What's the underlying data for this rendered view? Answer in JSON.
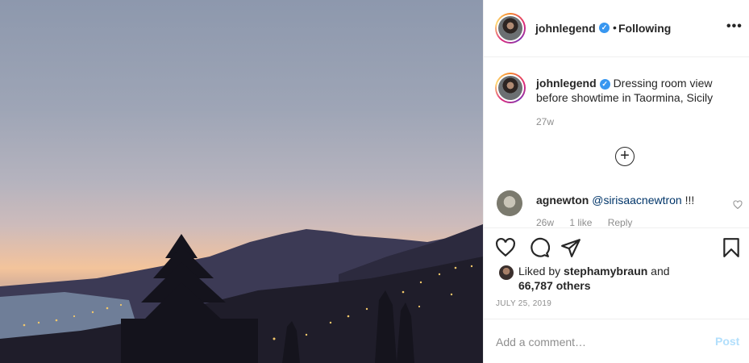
{
  "post": {
    "username": "johnlegend",
    "follow_state": "Following",
    "separator": "•",
    "more_glyph": "•••",
    "caption": "Dressing room view before showtime in Taormina, Sicily",
    "caption_time": "27w",
    "load_more_glyph": "+",
    "comments": [
      {
        "username": "agnewton",
        "mention": "@sirisaacnewtron",
        "text": " !!!",
        "time": "26w",
        "likes": "1 like",
        "reply": "Reply"
      }
    ],
    "likes": {
      "prefix": "Liked by ",
      "liker": "stephamybraun",
      "middle": " and",
      "others": "66,787 others"
    },
    "date": "JULY 25, 2019",
    "add_comment_placeholder": "Add a comment…",
    "post_label": "Post"
  },
  "icons": {
    "verified": "verified-badge-icon",
    "heart": "heart-icon",
    "comment": "comment-icon",
    "share": "share-icon",
    "save": "bookmark-icon"
  },
  "colors": {
    "verified": "#3897f0",
    "mention": "#003569",
    "post_disabled": "#b2dffc",
    "muted": "#8e8e8e"
  }
}
